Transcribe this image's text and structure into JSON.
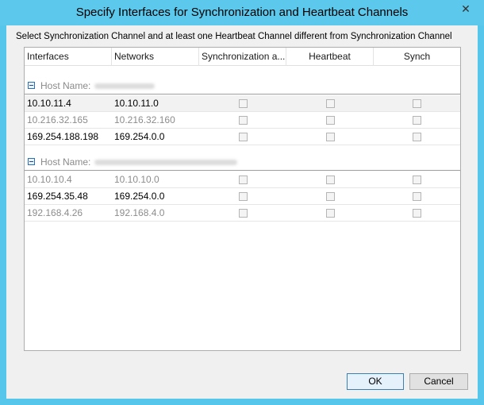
{
  "window": {
    "title": "Specify Interfaces for Synchronization and Heartbeat Channels",
    "close_symbol": "✕"
  },
  "instruction": "Select Synchronization Channel and at least one Heartbeat Channel different from Synchronization Channel",
  "columns": [
    "Interfaces",
    "Networks",
    "Synchronization a...",
    "Heartbeat",
    "Synch"
  ],
  "groups": [
    {
      "label": "Host Name:",
      "rows": [
        {
          "interface": "10.10.11.4",
          "network": "10.10.11.0",
          "enabled": true,
          "sync": false,
          "heartbeat": false,
          "synch": false
        },
        {
          "interface": "10.216.32.165",
          "network": "10.216.32.160",
          "enabled": false,
          "sync": false,
          "heartbeat": false,
          "synch": false
        },
        {
          "interface": "169.254.188.198",
          "network": "169.254.0.0",
          "enabled": true,
          "sync": false,
          "heartbeat": false,
          "synch": false
        }
      ]
    },
    {
      "label": "Host Name:",
      "rows": [
        {
          "interface": "10.10.10.4",
          "network": "10.10.10.0",
          "enabled": false,
          "sync": false,
          "heartbeat": false,
          "synch": false
        },
        {
          "interface": "169.254.35.48",
          "network": "169.254.0.0",
          "enabled": true,
          "sync": false,
          "heartbeat": false,
          "synch": false
        },
        {
          "interface": "192.168.4.26",
          "network": "192.168.4.0",
          "enabled": false,
          "sync": false,
          "heartbeat": false,
          "synch": false
        }
      ]
    }
  ],
  "buttons": {
    "ok": "OK",
    "cancel": "Cancel"
  },
  "colors": {
    "titlebar": "#5bc8ec",
    "dialog_bg": "#f0f0f0",
    "disabled_text": "#8c8c8c"
  }
}
